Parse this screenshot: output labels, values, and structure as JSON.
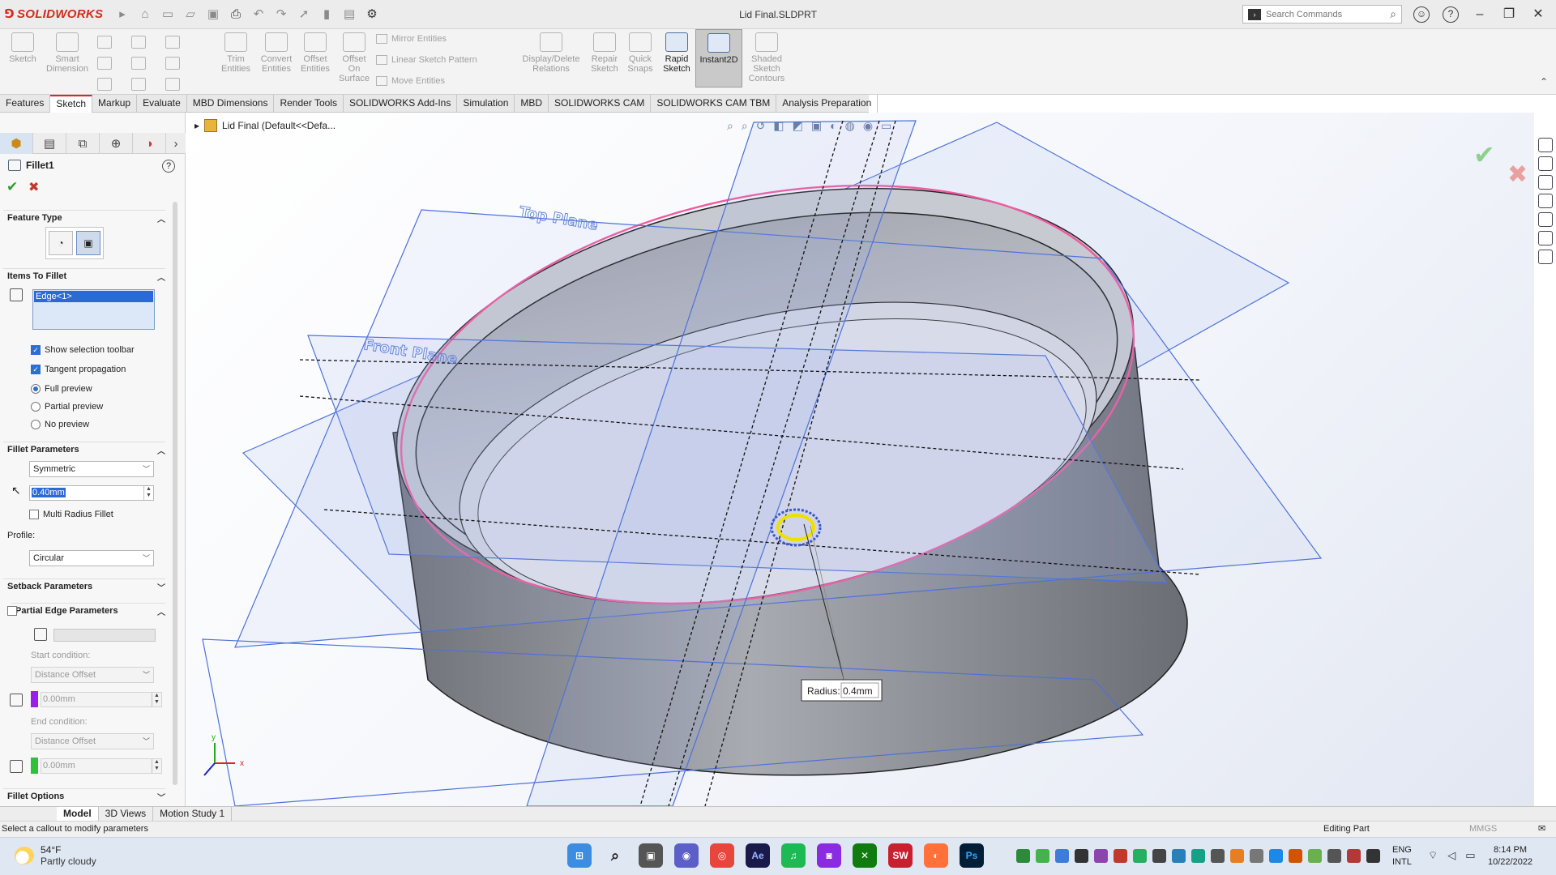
{
  "app": {
    "logo_text": "SOLIDWORKS",
    "document_title": "Lid Final.SLDPRT",
    "search_placeholder": "Search Commands"
  },
  "ribbon": {
    "sketch": "Sketch",
    "smart_dimension": "Smart Dimension",
    "trim_entities": "Trim Entities",
    "convert_entities": "Convert Entities",
    "offset_entities": "Offset Entities",
    "offset_on_surface": "Offset On Surface",
    "mirror_entities": "Mirror Entities",
    "linear_sketch_pattern": "Linear Sketch Pattern",
    "move_entities": "Move Entities",
    "display_delete_relations": "Display/Delete Relations",
    "repair_sketch": "Repair Sketch",
    "quick_snaps": "Quick Snaps",
    "rapid_sketch": "Rapid Sketch",
    "instant2d": "Instant2D",
    "shaded_sketch_contours": "Shaded Sketch Contours"
  },
  "tabs": [
    "Features",
    "Sketch",
    "Markup",
    "Evaluate",
    "MBD Dimensions",
    "Render Tools",
    "SOLIDWORKS Add-Ins",
    "Simulation",
    "MBD",
    "SOLIDWORKS CAM",
    "SOLIDWORKS CAM TBM",
    "Analysis Preparation"
  ],
  "property_manager": {
    "title": "Fillet1",
    "sections": {
      "feature_type": "Feature Type",
      "items_to_fillet": "Items To Fillet",
      "fillet_parameters": "Fillet Parameters",
      "setback_parameters": "Setback Parameters",
      "partial_edge_parameters": "Partial Edge Parameters",
      "fillet_options": "Fillet Options"
    },
    "selected_edge": "Edge<1>",
    "show_selection_toolbar": "Show selection toolbar",
    "tangent_propagation": "Tangent propagation",
    "full_preview": "Full preview",
    "partial_preview": "Partial preview",
    "no_preview": "No preview",
    "fillet_method": "Symmetric",
    "radius_value": "0.40mm",
    "multi_radius_fillet": "Multi Radius Fillet",
    "profile_label": "Profile:",
    "profile_value": "Circular",
    "start_condition_label": "Start condition:",
    "start_condition_value": "Distance Offset",
    "start_offset_value": "0.00mm",
    "end_condition_label": "End condition:",
    "end_condition_value": "Distance Offset",
    "end_offset_value": "0.00mm"
  },
  "viewport": {
    "tree_label": "Lid Final  (Default<<Defa...",
    "top_plane_label": "Top Plane",
    "front_plane_label": "Front Plane",
    "radius_callout_label": "Radius:",
    "radius_callout_value": "0.4mm",
    "axis_x": "x",
    "axis_y": "y",
    "colors": {
      "model_body": "#8c8e95",
      "planes": "#4d72d9",
      "selected_edge": "#f05aa0",
      "highlight": "#f0e000"
    }
  },
  "bottom_tabs": [
    "Model",
    "3D Views",
    "Motion Study 1"
  ],
  "status": {
    "message": "Select a callout to modify parameters",
    "mode": "Editing Part",
    "units": "MMGS"
  },
  "taskbar": {
    "temperature": "54°F",
    "weather": "Partly cloudy",
    "lang_top": "ENG",
    "lang_bottom": "INTL",
    "time": "8:14 PM",
    "date": "10/22/2022"
  }
}
